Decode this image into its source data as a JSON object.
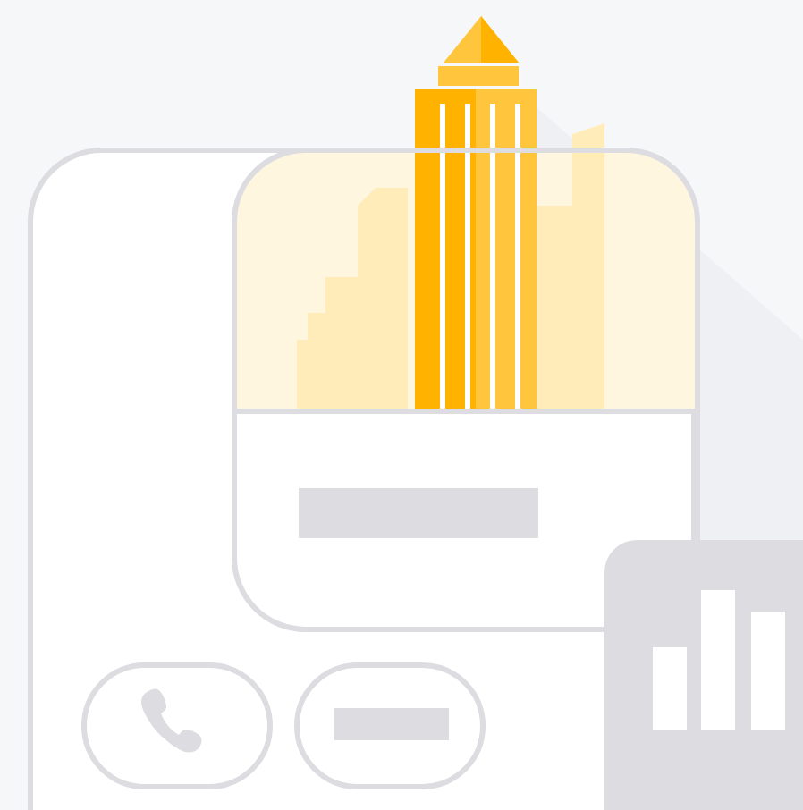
{
  "illustration": {
    "kind": "city-card"
  },
  "buttons": [
    {
      "kind": "phone"
    },
    {
      "kind": "bar"
    }
  ],
  "chart": {
    "kind": "bars"
  }
}
